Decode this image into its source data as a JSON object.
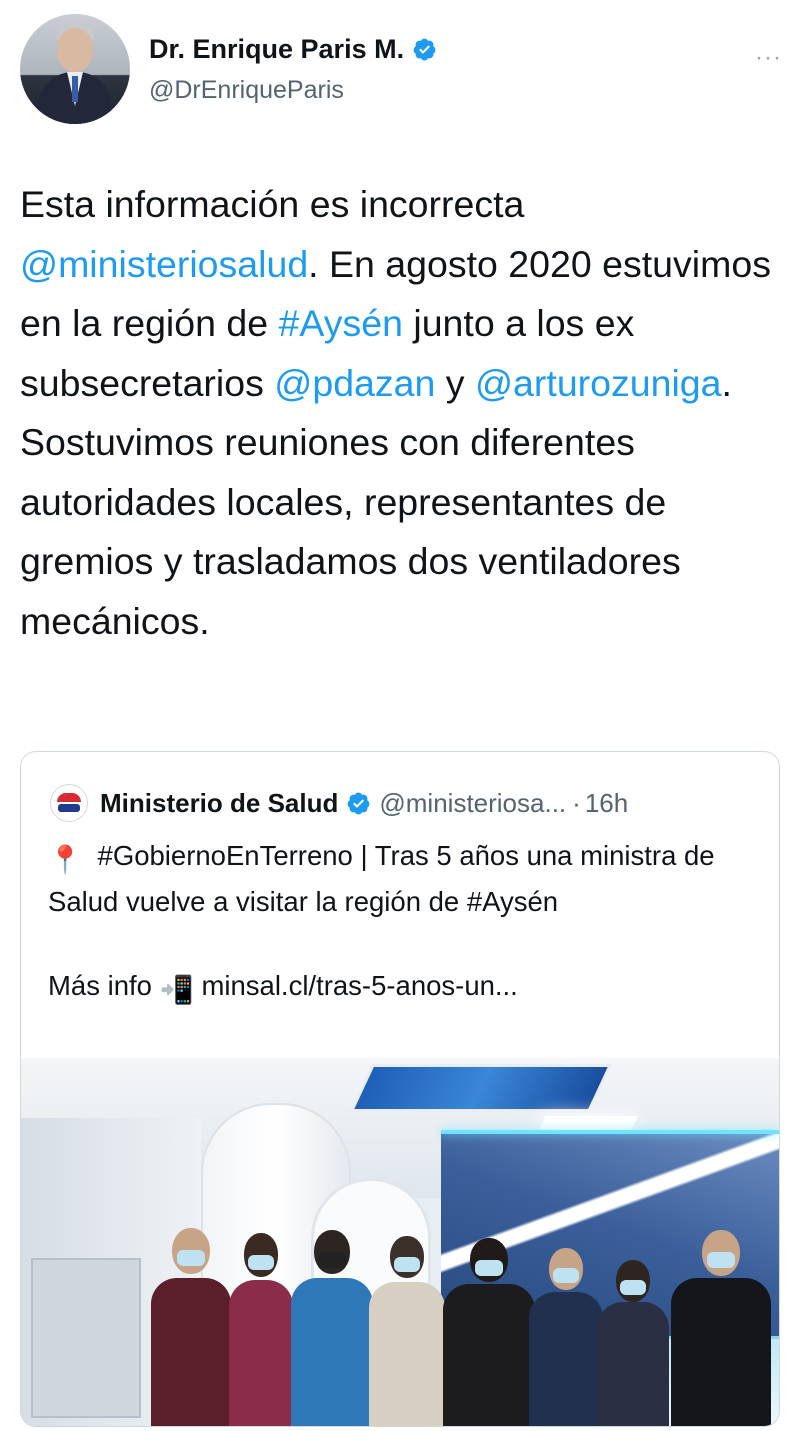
{
  "author": {
    "name": "Dr. Enrique Paris M.",
    "handle": "@DrEnriqueParis",
    "verified": true,
    "avatar_icon": "author-avatar"
  },
  "menu": {
    "icon": "more-options-icon",
    "label": "···"
  },
  "tweet": {
    "segments": [
      {
        "text": "Esta información es incorrecta ",
        "link": false
      },
      {
        "text": "@ministeriosalud",
        "link": true
      },
      {
        "text": ". En agosto 2020 estuvimos en la región de ",
        "link": false
      },
      {
        "text": "#Aysén",
        "link": true
      },
      {
        "text": " junto a los ex subsecretarios ",
        "link": false
      },
      {
        "text": "@pdazan",
        "link": true
      },
      {
        "text": " y ",
        "link": false
      },
      {
        "text": "@arturozuniga",
        "link": true
      },
      {
        "text": ". Sostuvimos reuniones con diferentes autoridades locales, representantes de gremios y trasladamos dos ventiladores mecánicos.",
        "link": false
      }
    ]
  },
  "quote": {
    "name": "Ministerio de Salud",
    "handle": "@ministeriosa...",
    "separator": "·",
    "time": "16h",
    "verified": true,
    "line1_emoji": "📍",
    "line1": "#GobiernoEnTerreno | Tras 5 años una ministra de Salud vuelve a visitar la región de #Aysén",
    "more_label": "Más info",
    "more_emoji": "📲",
    "url": "minsal.cl/tras-5-anos-un..."
  },
  "colors": {
    "link": "#1d9bf0",
    "text": "#0f1419",
    "secondary": "#536471",
    "border": "#cfd9de"
  }
}
